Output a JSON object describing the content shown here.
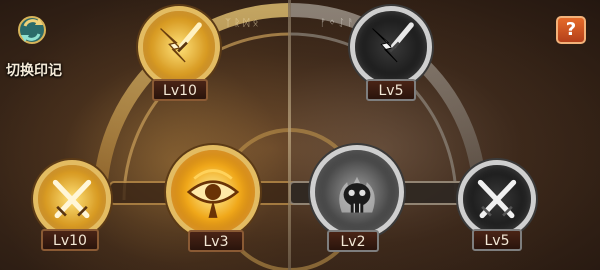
{
  "switch_button": {
    "label": "切换印记",
    "icon": "swap-arrows-icon"
  },
  "help_button": {
    "label": "?",
    "icon": "question-icon"
  },
  "left_panel": {
    "theme_color": "#e3bc62",
    "slots": [
      {
        "id": "top",
        "icon": "lightning-sword-icon",
        "level": "Lv10"
      },
      {
        "id": "left",
        "icon": "crossed-swords-icon",
        "level": "Lv10"
      },
      {
        "id": "center",
        "icon": "eye-emblem-icon",
        "level": "Lv3"
      }
    ]
  },
  "right_panel": {
    "theme_color": "#cfcfcf",
    "slots": [
      {
        "id": "top",
        "icon": "lightning-sword-icon",
        "level": "Lv5"
      },
      {
        "id": "center",
        "icon": "flame-skull-emblem-icon",
        "level": "Lv2"
      },
      {
        "id": "right",
        "icon": "crossed-swords-icon",
        "level": "Lv5"
      }
    ]
  }
}
